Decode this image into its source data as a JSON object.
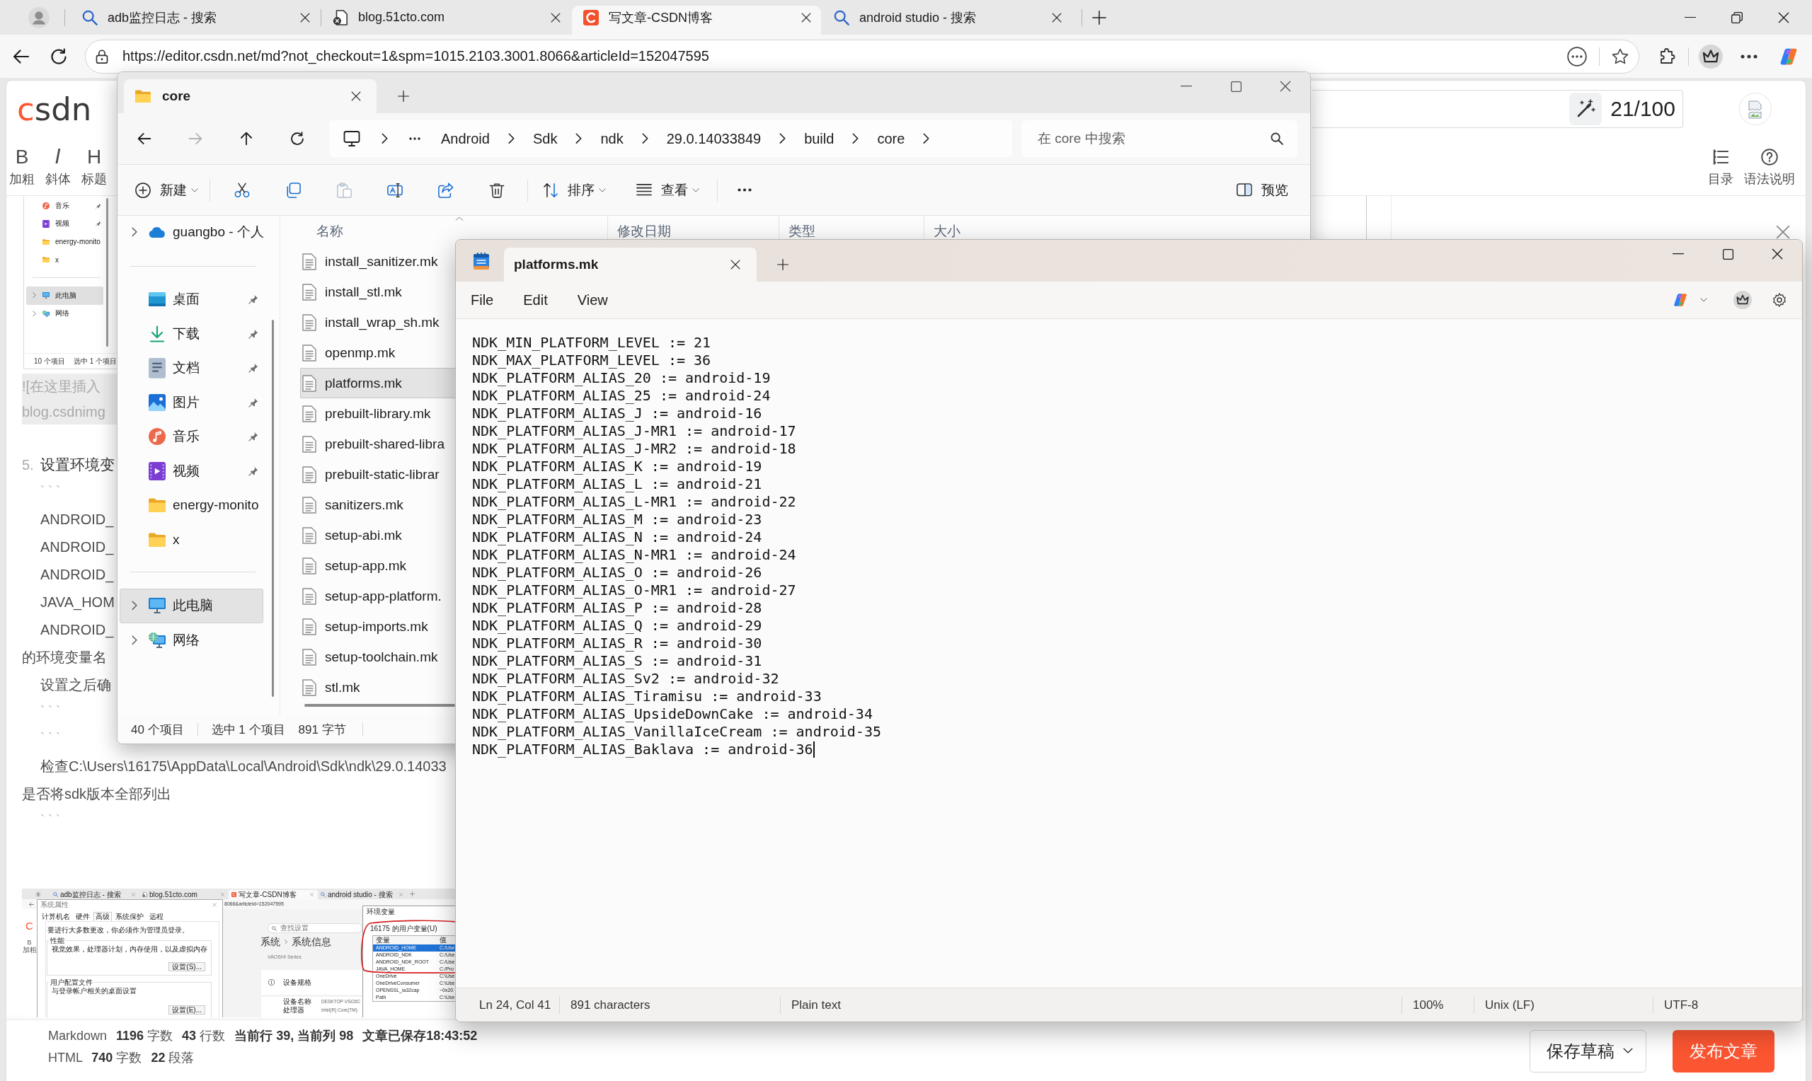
{
  "browser": {
    "tabs": [
      {
        "title": "adb监控日志 - 搜索",
        "kind": "search",
        "selected": false
      },
      {
        "title": "blog.51cto.com",
        "kind": "error",
        "selected": false
      },
      {
        "title": "写文章-CSDN博客",
        "kind": "csdn",
        "selected": true
      },
      {
        "title": "android studio - 搜索",
        "kind": "search",
        "selected": false
      }
    ],
    "address": "https://editor.csdn.net/md?not_checkout=1&spm=1015.2103.3001.8066&articleId=152047595"
  },
  "editor": {
    "logo": "csdn",
    "title_counter": "21/100",
    "format_tools": [
      {
        "glyph": "B",
        "label": "加粗",
        "kind": "bold"
      },
      {
        "glyph": "I",
        "label": "斜体",
        "kind": "italic"
      },
      {
        "glyph": "H",
        "label": "标题",
        "kind": "heading"
      }
    ],
    "side_tools": [
      {
        "label": "目录",
        "kind": "toc"
      },
      {
        "label": "语法说明",
        "kind": "help"
      }
    ],
    "blocks": [
      {
        "kind": "screenshot",
        "nav_groups": [
          {
            "items": [
              {
                "label": "音乐",
                "kind": "music",
                "pinned": true,
                "selected": false
              },
              {
                "label": "视频",
                "kind": "videos",
                "pinned": true,
                "selected": false
              },
              {
                "label": "energy-monito",
                "kind": "folder",
                "pinned": false,
                "selected": false
              },
              {
                "label": "x",
                "kind": "folder",
                "pinned": false,
                "selected": false
              }
            ]
          },
          {
            "items": [
              {
                "label": "此电脑",
                "kind": "pc",
                "pinned": false,
                "selected": true
              },
              {
                "label": "网络",
                "kind": "network",
                "pinned": false,
                "selected": false
              }
            ]
          }
        ],
        "status": [
          "10 个项目",
          "选中 1 个项目"
        ]
      },
      {
        "kind": "highlight",
        "lines": [
          "![在这里插入",
          "blog.csdnimg"
        ]
      },
      {
        "kind": "heading",
        "number": "5.",
        "text": "设置环境变"
      },
      {
        "kind": "fence",
        "text": "```"
      },
      {
        "kind": "indented",
        "text": "ANDROID_"
      },
      {
        "kind": "indented",
        "text": "ANDROID_"
      },
      {
        "kind": "indented",
        "text": "ANDROID_"
      },
      {
        "kind": "indented",
        "text": "JAVA_HOM"
      },
      {
        "kind": "indented",
        "text": "ANDROID_"
      },
      {
        "kind": "text",
        "text": "的环境变量名"
      },
      {
        "kind": "indented",
        "text": "设置之后确"
      },
      {
        "kind": "fence",
        "text": "```"
      },
      {
        "kind": "fence",
        "text": "```"
      },
      {
        "kind": "indented",
        "text": "检查C:\\Users\\16175\\AppData\\Local\\Android\\Sdk\\ndk\\29.0.14033"
      },
      {
        "kind": "text",
        "text": "是否将sdk版本全部列出"
      },
      {
        "kind": "fence",
        "text": "```"
      },
      {
        "kind": "screenshot_wide",
        "tabs": [
          {
            "title": "adb监控日志 - 搜索",
            "kind": "search",
            "selected": false
          },
          {
            "title": "blog.51cto.com",
            "kind": "error",
            "selected": false
          },
          {
            "title": "写文章-CSDN博客",
            "kind": "csdn",
            "selected": true
          },
          {
            "title": "android studio - 搜索",
            "kind": "search",
            "selected": false
          }
        ],
        "address": "8066&articleId=152047595",
        "page_logo": "C",
        "page_tool": {
          "glyph": "B",
          "label": "加粗"
        },
        "dialog": {
          "title": "系统属性",
          "tabs": [
            {
              "label": "计算机名",
              "selected": false
            },
            {
              "label": "硬件",
              "selected": false
            },
            {
              "label": "高级",
              "selected": true
            },
            {
              "label": "系统保护",
              "selected": false
            },
            {
              "label": "远程",
              "selected": false
            }
          ],
          "notice": "要进行大多数更改，你必须作为管理员登录。",
          "groups": [
            {
              "title": "性能",
              "text": "视觉效果，处理器计划，内存使用，以及虚拟内存",
              "button": "设置(S)..."
            },
            {
              "title": "用户配置文件",
              "text": "与登录帐户相关的桌面设置",
              "button": "设置(E)..."
            }
          ]
        },
        "settings": {
          "search": {
            "placeholder": "查找设置"
          },
          "breadcrumb": [
            "系统",
            "系统信息"
          ],
          "device": "VAOSHI Series",
          "section": "设备规格",
          "specs": [
            {
              "label": "设备名称",
              "value": "DESKTOP-VSG5C"
            },
            {
              "label": "处理器",
              "value": "Intel(R) Core(TM)"
            }
          ]
        },
        "env_dialog": {
          "title": "环境变量",
          "group": "16175 的用户变量(U)",
          "columns": [
            "变量",
            "值"
          ],
          "rows": [
            {
              "name": "ANDROID_HOME",
              "value": "C:/Use",
              "selected": true
            },
            {
              "name": "ANDROID_NDK",
              "value": "C:/Use",
              "selected": false
            },
            {
              "name": "ANDROID_NDK_ROOT",
              "value": "C:/Use",
              "selected": false
            },
            {
              "name": "JAVA_HOME",
              "value": "C:/Pro",
              "selected": false
            },
            {
              "name": "OneDrive",
              "value": "C:\\Use",
              "selected": false
            },
            {
              "name": "OneDriveConsumer",
              "value": "C:\\Use",
              "selected": false
            },
            {
              "name": "OPENSSL_ia32cap",
              "value": "~0x20",
              "selected": false
            },
            {
              "name": "Path",
              "value": "C:\\Use",
              "selected": false
            }
          ]
        }
      }
    ],
    "footer": {
      "stats": [
        "Markdown **1196** 字数 **43** 行数 **当前行 39, 当前列 98** **文章已保存18:43:52**",
        "HTML **740** 字数 **22** 段落"
      ],
      "buttons": [
        {
          "label": "保存草稿",
          "kind": "draft"
        },
        {
          "label": "发布文章",
          "kind": "publish"
        }
      ]
    }
  },
  "explorer": {
    "tab": "core",
    "nav_buttons": [
      {
        "kind": "back",
        "disabled": false
      },
      {
        "kind": "forward",
        "disabled": true
      },
      {
        "kind": "up",
        "disabled": false
      },
      {
        "kind": "refresh",
        "disabled": false
      }
    ],
    "path": [
      "Android",
      "Sdk",
      "ndk",
      "29.0.14033849",
      "build",
      "core"
    ],
    "search": {
      "placeholder": "在 core 中搜索"
    },
    "command_groups": [
      {
        "items": [
          {
            "kind": "new",
            "label": "新建",
            "disabled": false
          }
        ]
      },
      {
        "items": [
          {
            "kind": "cut",
            "disabled": false
          },
          {
            "kind": "copy",
            "disabled": false
          },
          {
            "kind": "paste",
            "disabled": true
          },
          {
            "kind": "rename",
            "disabled": false
          },
          {
            "kind": "share",
            "disabled": false
          },
          {
            "kind": "delete",
            "disabled": false
          }
        ]
      },
      {
        "items": [
          {
            "kind": "sort",
            "label": "排序",
            "disabled": false
          },
          {
            "kind": "view",
            "label": "查看",
            "disabled": false
          }
        ]
      },
      {
        "items": [
          {
            "kind": "more",
            "disabled": false
          }
        ]
      }
    ],
    "preview_label": "预览",
    "nav_groups": [
      {
        "items": [
          {
            "label": "guangbo - 个人",
            "kind": "cloud",
            "pinned": false,
            "selected": false
          }
        ]
      },
      {
        "items": [
          {
            "label": "桌面",
            "kind": "desktop",
            "pinned": true,
            "selected": false
          },
          {
            "label": "下载",
            "kind": "download",
            "pinned": true,
            "selected": false
          },
          {
            "label": "文档",
            "kind": "documents",
            "pinned": true,
            "selected": false
          },
          {
            "label": "图片",
            "kind": "pictures",
            "pinned": true,
            "selected": false
          },
          {
            "label": "音乐",
            "kind": "music",
            "pinned": true,
            "selected": false
          },
          {
            "label": "视频",
            "kind": "videos",
            "pinned": true,
            "selected": false
          },
          {
            "label": "energy-monito",
            "kind": "folder",
            "pinned": false,
            "selected": false
          },
          {
            "label": "x",
            "kind": "folder",
            "pinned": false,
            "selected": false
          }
        ]
      },
      {
        "items": [
          {
            "label": "此电脑",
            "kind": "pc",
            "pinned": false,
            "selected": true
          },
          {
            "label": "网络",
            "kind": "network",
            "pinned": false,
            "selected": false
          }
        ]
      }
    ],
    "columns": [
      "名称",
      "修改日期",
      "类型",
      "大小"
    ],
    "files": [
      {
        "name": "install_sanitizer.mk",
        "selected": false
      },
      {
        "name": "install_stl.mk",
        "selected": false
      },
      {
        "name": "install_wrap_sh.mk",
        "selected": false
      },
      {
        "name": "openmp.mk",
        "selected": false
      },
      {
        "name": "platforms.mk",
        "selected": true
      },
      {
        "name": "prebuilt-library.mk",
        "selected": false
      },
      {
        "name": "prebuilt-shared-libra",
        "selected": false
      },
      {
        "name": "prebuilt-static-librar",
        "selected": false
      },
      {
        "name": "sanitizers.mk",
        "selected": false
      },
      {
        "name": "setup-abi.mk",
        "selected": false
      },
      {
        "name": "setup-app.mk",
        "selected": false
      },
      {
        "name": "setup-app-platform.",
        "selected": false
      },
      {
        "name": "setup-imports.mk",
        "selected": false
      },
      {
        "name": "setup-toolchain.mk",
        "selected": false
      },
      {
        "name": "stl.mk",
        "selected": false
      }
    ],
    "status": [
      "40 个项目",
      "选中 1 个项目",
      "891 字节"
    ]
  },
  "notepad": {
    "tab": "platforms.mk",
    "menu": [
      "File",
      "Edit",
      "View"
    ],
    "lines": [
      "NDK_MIN_PLATFORM_LEVEL := 21",
      "NDK_MAX_PLATFORM_LEVEL := 36",
      "NDK_PLATFORM_ALIAS_20 := android-19",
      "NDK_PLATFORM_ALIAS_25 := android-24",
      "NDK_PLATFORM_ALIAS_J := android-16",
      "NDK_PLATFORM_ALIAS_J-MR1 := android-17",
      "NDK_PLATFORM_ALIAS_J-MR2 := android-18",
      "NDK_PLATFORM_ALIAS_K := android-19",
      "NDK_PLATFORM_ALIAS_L := android-21",
      "NDK_PLATFORM_ALIAS_L-MR1 := android-22",
      "NDK_PLATFORM_ALIAS_M := android-23",
      "NDK_PLATFORM_ALIAS_N := android-24",
      "NDK_PLATFORM_ALIAS_N-MR1 := android-24",
      "NDK_PLATFORM_ALIAS_O := android-26",
      "NDK_PLATFORM_ALIAS_O-MR1 := android-27",
      "NDK_PLATFORM_ALIAS_P := android-28",
      "NDK_PLATFORM_ALIAS_Q := android-29",
      "NDK_PLATFORM_ALIAS_R := android-30",
      "NDK_PLATFORM_ALIAS_S := android-31",
      "NDK_PLATFORM_ALIAS_Sv2 := android-32",
      "NDK_PLATFORM_ALIAS_Tiramisu := android-33",
      "NDK_PLATFORM_ALIAS_UpsideDownCake := android-34",
      "NDK_PLATFORM_ALIAS_VanillaIceCream := android-35",
      "NDK_PLATFORM_ALIAS_Baklava := android-36"
    ],
    "caret_visible": true,
    "status": [
      "Ln 24, Col 41",
      "891 characters",
      "Plain text",
      "100%",
      "Unix (LF)",
      "UTF-8"
    ]
  }
}
